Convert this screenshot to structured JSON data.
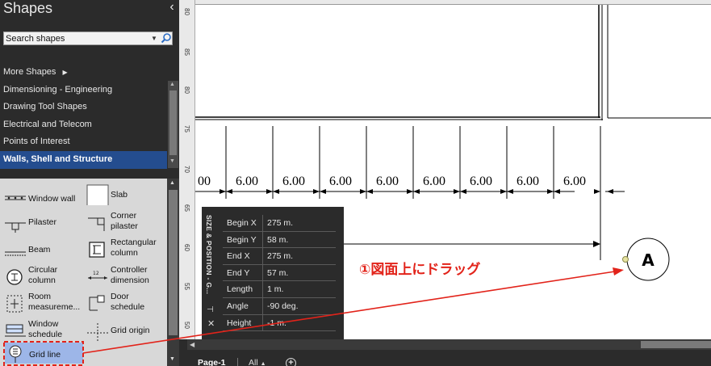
{
  "panel": {
    "title": "Shapes",
    "collapse_glyph": "‹",
    "search_placeholder": "Search shapes",
    "categories": [
      {
        "label": "More Shapes"
      },
      {
        "label": "Dimensioning - Engineering"
      },
      {
        "label": "Drawing Tool Shapes"
      },
      {
        "label": "Electrical and Telecom"
      },
      {
        "label": "Points of Interest"
      },
      {
        "label": "Walls, Shell and Structure",
        "active": true
      }
    ]
  },
  "stencil": {
    "shapes": [
      {
        "label": "Window wall",
        "icon": "window-wall-icon"
      },
      {
        "label": "Slab",
        "icon": "slab-icon"
      },
      {
        "label": "Pilaster",
        "icon": "pilaster-icon"
      },
      {
        "label": "Corner pilaster",
        "line1": "Corner",
        "line2": "pilaster",
        "icon": "corner-pilaster-icon"
      },
      {
        "label": "Beam",
        "icon": "beam-icon"
      },
      {
        "label": "Rectangular column",
        "line1": "Rectangular",
        "line2": "column",
        "icon": "rectangular-column-icon"
      },
      {
        "label": "Circular column",
        "line1": "Circular",
        "line2": "column",
        "icon": "circular-column-icon"
      },
      {
        "label": "Controller dimension",
        "line1": "Controller",
        "line2": "dimension",
        "icon": "controller-dimension-icon"
      },
      {
        "label": "Room measureme...",
        "line1": "Room",
        "line2": "measureme...",
        "icon": "room-measurement-icon"
      },
      {
        "label": "Door schedule",
        "line1": "Door",
        "line2": "schedule",
        "icon": "door-schedule-icon"
      },
      {
        "label": "Window schedule",
        "line1": "Window",
        "line2": "schedule",
        "icon": "window-schedule-icon"
      },
      {
        "label": "Grid origin",
        "icon": "grid-origin-icon"
      },
      {
        "label": "Grid line",
        "icon": "grid-line-icon",
        "selected": true
      }
    ]
  },
  "rulers": {
    "vertical_labels": [
      "80",
      "85",
      "80",
      "75",
      "70",
      "65",
      "60",
      "55",
      "50"
    ]
  },
  "drawing": {
    "dimensions": [
      "00",
      "6.00",
      "6.00",
      "6.00",
      "6.00",
      "6.00",
      "6.00",
      "6.00",
      "6.00"
    ],
    "grid_bubble_label": "A"
  },
  "size_position": {
    "title": "SIZE & POSITION - G...",
    "rows": [
      {
        "key": "Begin X",
        "value": "275 m."
      },
      {
        "key": "Begin Y",
        "value": "58 m."
      },
      {
        "key": "End X",
        "value": "275 m."
      },
      {
        "key": "End Y",
        "value": "57 m."
      },
      {
        "key": "Length",
        "value": "1 m."
      },
      {
        "key": "Angle",
        "value": "-90 deg."
      },
      {
        "key": "Height",
        "value": "-1 m."
      }
    ]
  },
  "annotation": {
    "text": "①図面上にドラッグ",
    "color": "#e2231a"
  },
  "tabs": {
    "page": "Page-1",
    "all": "All",
    "add": "+"
  },
  "colors": {
    "panel_bg": "#2b2b2b",
    "active_category": "#244d8f",
    "stencil_bg": "#d8d8d8",
    "selected_shape": "#9db6e8"
  }
}
